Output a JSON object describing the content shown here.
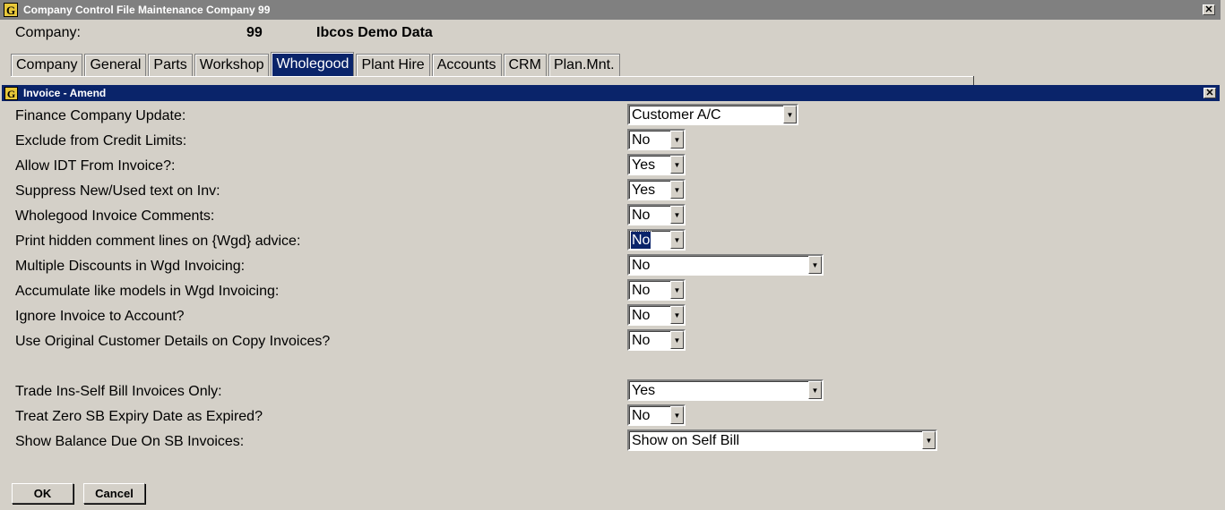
{
  "window": {
    "title": "Company Control File Maintenance  Company  99",
    "app_icon": "G"
  },
  "company": {
    "label": "Company:",
    "number": "99",
    "name": "Ibcos Demo Data"
  },
  "tabs": [
    "Company",
    "General",
    "Parts",
    "Workshop",
    "Wholegood",
    "Plant Hire",
    "Accounts",
    "CRM",
    "Plan.Mnt."
  ],
  "active_tab": "Wholegood",
  "dialog": {
    "title": "Invoice - Amend",
    "app_icon": "G"
  },
  "fields": [
    {
      "label": "Finance Company Update:",
      "value": "Customer A/C"
    },
    {
      "label": "Exclude from Credit Limits:",
      "value": "No"
    },
    {
      "label": "Allow IDT From Invoice?:",
      "value": "Yes"
    },
    {
      "label": "Suppress New/Used text on Inv:",
      "value": "Yes"
    },
    {
      "label": "Wholegood Invoice Comments:",
      "value": "No"
    },
    {
      "label": "Print hidden comment lines on {Wgd} advice:",
      "value": "No"
    },
    {
      "label": "Multiple Discounts in Wgd Invoicing:",
      "value": "No"
    },
    {
      "label": "Accumulate like models in Wgd Invoicing:",
      "value": "No"
    },
    {
      "label": "Ignore Invoice to Account?",
      "value": "No"
    },
    {
      "label": "Use Original Customer Details on Copy Invoices?",
      "value": "No"
    },
    {
      "label": "Trade Ins-Self Bill Invoices Only:",
      "value": "Yes"
    },
    {
      "label": "Treat Zero SB Expiry Date as Expired?",
      "value": "No"
    },
    {
      "label": "Show Balance Due On SB Invoices:",
      "value": "Show on Self Bill"
    }
  ],
  "buttons": {
    "ok": "OK",
    "cancel": "Cancel"
  },
  "colors": {
    "title_active": "#0a246a",
    "title_inactive": "#808080",
    "face": "#d4d0c8"
  },
  "icons": {
    "close": "close-icon",
    "dropdown": "chevron-down-icon"
  }
}
